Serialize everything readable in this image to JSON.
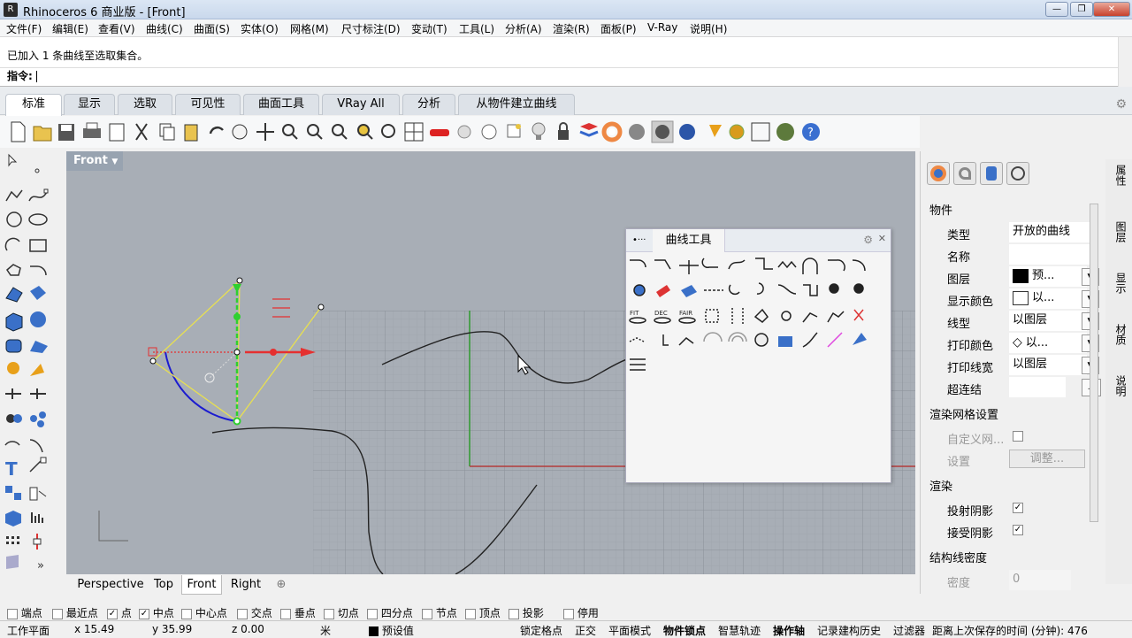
{
  "window": {
    "title": "Rhinoceros 6 商业版 - [Front]",
    "controls": [
      "—",
      "❐",
      "✕"
    ]
  },
  "menu": [
    "文件(F)",
    "编辑(E)",
    "查看(V)",
    "曲线(C)",
    "曲面(S)",
    "实体(O)",
    "网格(M)",
    "尺寸标注(D)",
    "变动(T)",
    "工具(L)",
    "分析(A)",
    "渲染(R)",
    "面板(P)",
    "V-Ray",
    "说明(H)"
  ],
  "command": {
    "history": "已加入 1 条曲线至选取集合。",
    "prompt": "指令:"
  },
  "tabs": [
    "标准",
    "显示",
    "选取",
    "可见性",
    "曲面工具",
    "VRay All",
    "分析",
    "从物件建立曲线"
  ],
  "viewport": {
    "name": "Front",
    "menu_arrow": "▼"
  },
  "curve_tools": {
    "title": "曲线工具"
  },
  "properties": {
    "section_object": "物件",
    "rows": [
      {
        "label": "类型",
        "value": "开放的曲线"
      },
      {
        "label": "名称",
        "value": ""
      },
      {
        "label": "图层",
        "value": "预..."
      },
      {
        "label": "显示颜色",
        "value": "以..."
      },
      {
        "label": "线型",
        "value": "以图层"
      },
      {
        "label": "打印颜色",
        "value": "以..."
      },
      {
        "label": "打印线宽",
        "value": "以图层"
      },
      {
        "label": "超连结",
        "value": "..."
      }
    ],
    "section_mesh": "渲染网格设置",
    "mesh_rows": [
      {
        "label": "自定义网...",
        "value": ""
      },
      {
        "label": "设置",
        "value": "调整..."
      }
    ],
    "section_render": "渲染",
    "render_rows": [
      {
        "label": "投射阴影",
        "value": "✓"
      },
      {
        "label": "接受阴影",
        "value": "✓"
      }
    ],
    "section_iso": "结构线密度",
    "iso_rows": [
      {
        "label": "密度",
        "value": "0"
      }
    ]
  },
  "side_tabs": [
    "属性",
    "图层",
    "显示",
    "材质",
    "说明"
  ],
  "viewport_tabs": [
    "Perspective",
    "Top",
    "Front",
    "Right",
    "⊕"
  ],
  "osnaps": [
    {
      "label": "端点",
      "checked": false
    },
    {
      "label": "最近点",
      "checked": false
    },
    {
      "label": "点",
      "checked": true
    },
    {
      "label": "中点",
      "checked": true
    },
    {
      "label": "中心点",
      "checked": false
    },
    {
      "label": "交点",
      "checked": false
    },
    {
      "label": "垂点",
      "checked": false
    },
    {
      "label": "切点",
      "checked": false
    },
    {
      "label": "四分点",
      "checked": false
    },
    {
      "label": "节点",
      "checked": false
    },
    {
      "label": "顶点",
      "checked": false
    },
    {
      "label": "投影",
      "checked": false
    },
    {
      "label": "停用",
      "checked": false
    }
  ],
  "status": {
    "cplane": "工作平面",
    "x": "x 15.49",
    "y": "y 35.99",
    "z": "z 0.00",
    "unit": "米",
    "layer": "预设值",
    "grid_snap": "锁定格点",
    "ortho": "正交",
    "planar": "平面模式",
    "osnap": "物件锁点",
    "smarttrack": "智慧轨迹",
    "gumball": "操作轴",
    "history": "记录建构历史",
    "filter": "过滤器",
    "saved": "距离上次保存的时间 (分钟): 476"
  },
  "colors": {
    "viewport_bg": "#a8aeb6",
    "grid": "#8f959d",
    "x_axis": "#b23b3b",
    "y_axis": "#2f9a2f",
    "selected": "#1b1bd0",
    "gumball": "#e53030"
  }
}
